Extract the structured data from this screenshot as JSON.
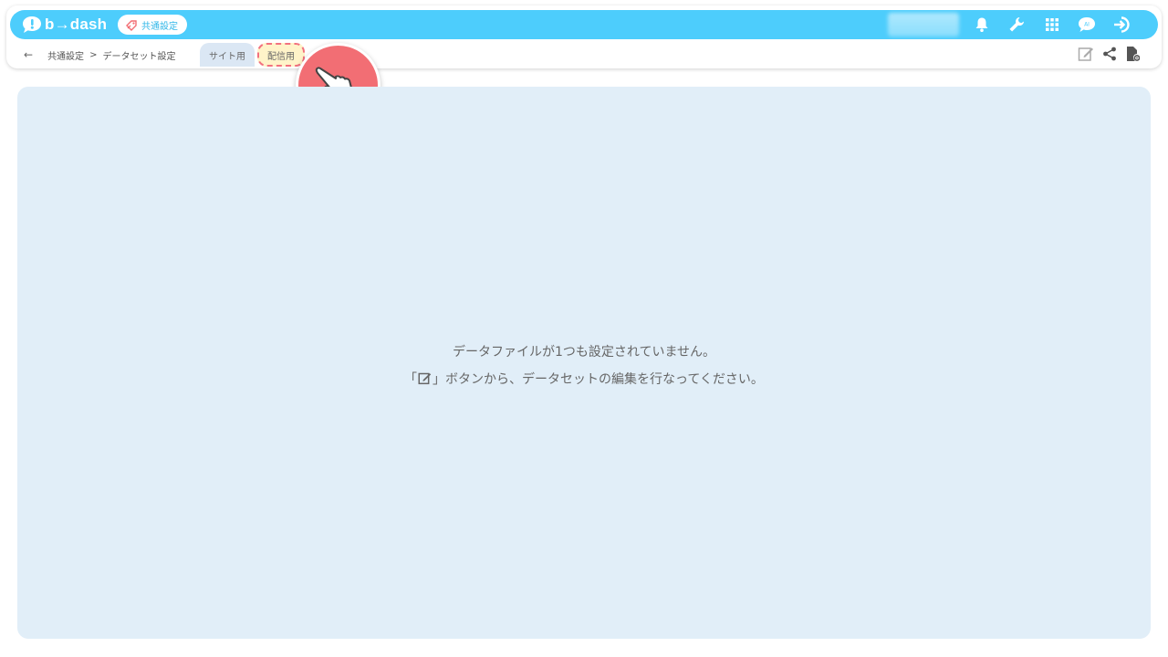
{
  "app": {
    "logo_text": "b→dash",
    "badge_label": "共通設定"
  },
  "topbar_icons": [
    "bell-icon",
    "wrench-icon",
    "grid-icon",
    "chat-icon",
    "logout-icon"
  ],
  "breadcrumb": {
    "back_icon": "←",
    "items": [
      "共通設定",
      "データセット設定"
    ],
    "separator": ">"
  },
  "tabs": [
    {
      "label": "サイト用",
      "active": true
    },
    {
      "label": "配信用",
      "active": false,
      "highlighted": true
    }
  ],
  "action_icons": [
    "edit-icon",
    "share-icon",
    "file-settings-icon"
  ],
  "empty_state": {
    "line1": "データファイルが1つも設定されていません。",
    "line2_prefix": "「",
    "line2_suffix": "」ボタンから、データセットの編集を行なってください。"
  },
  "colors": {
    "topbar": "#4dcdfc",
    "panel": "#e1eef8",
    "highlight_border": "#f2717e",
    "highlight_fill": "#fff3c9",
    "pointer": "#f26e74"
  }
}
